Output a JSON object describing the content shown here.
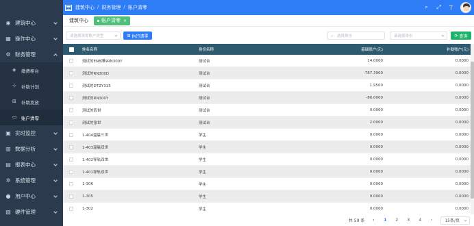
{
  "header": {
    "breadcrumbs": [
      "建筑中心",
      "财务管理",
      "账户清零"
    ]
  },
  "sidebar": {
    "items": [
      {
        "label": "建筑中心",
        "icon": "dashboard-icon"
      },
      {
        "label": "操作中心",
        "icon": "grid-icon"
      },
      {
        "label": "财务管理",
        "icon": "finance-icon",
        "expanded": true
      },
      {
        "label": "实时监控",
        "icon": "monitor-icon"
      },
      {
        "label": "数据分析",
        "icon": "chart-icon"
      },
      {
        "label": "报表中心",
        "icon": "report-icon"
      },
      {
        "label": "系统管理",
        "icon": "gear-icon"
      },
      {
        "label": "用户中心",
        "icon": "user-icon"
      },
      {
        "label": "硬件管理",
        "icon": "hardware-icon"
      }
    ],
    "finance_sub": [
      {
        "label": "缴费柜台",
        "icon": "counter-icon"
      },
      {
        "label": "补助计划",
        "icon": "plan-icon"
      },
      {
        "label": "补助发放",
        "icon": "grant-icon"
      },
      {
        "label": "账户清零",
        "icon": "clear-icon",
        "active": true
      }
    ]
  },
  "tags": {
    "home": "建筑中心",
    "active": "账户清零",
    "close": "×"
  },
  "toolbar": {
    "account_type_placeholder": "请选择清零账户类型",
    "execute_label": "执行清零",
    "role_select_placeholder": "选择身份",
    "role_filter_placeholder": "请选择身份",
    "query_label": "查询"
  },
  "table": {
    "columns": [
      "姓名名称",
      "身份名称",
      "基础账户(元)",
      "补助账户(元)"
    ],
    "rows": [
      {
        "name": "测试的ENB博9RN300Y",
        "role": "测试台",
        "basic": "14.0000",
        "subsidy": "0.0000"
      },
      {
        "name": "测试的RN300D",
        "role": "测试台",
        "basic": "-787.3900",
        "subsidy": "0.0000"
      },
      {
        "name": "测试的DTZY315",
        "role": "测试台",
        "basic": "1.9500",
        "subsidy": "0.0000"
      },
      {
        "name": "测试的RN300Y",
        "role": "测试台",
        "basic": "-86.0000",
        "subsidy": "0.0000"
      },
      {
        "name": "测试的四世",
        "role": "测试台",
        "basic": "0.0000",
        "subsidy": "0.0000"
      },
      {
        "name": "测试的张世",
        "role": "测试台",
        "basic": "2.0000",
        "subsidy": "0.0000"
      },
      {
        "name": "1-404温晨三世",
        "role": "学生",
        "basic": "0.0000",
        "subsidy": "0.0000"
      },
      {
        "name": "1-403温晨双世",
        "role": "学生",
        "basic": "0.0000",
        "subsidy": "0.0000"
      },
      {
        "name": "1-402导轨四世",
        "role": "学生",
        "basic": "0.0000",
        "subsidy": "0.0000"
      },
      {
        "name": "1-401导轨双世",
        "role": "学生",
        "basic": "0.0000",
        "subsidy": "0.0000"
      },
      {
        "name": "1-306",
        "role": "学生",
        "basic": "0.0000",
        "subsidy": "0.0000"
      },
      {
        "name": "1-305",
        "role": "学生",
        "basic": "0.0000",
        "subsidy": "0.0000"
      },
      {
        "name": "1-302",
        "role": "学生",
        "basic": "0.0000",
        "subsidy": "0.0000"
      }
    ]
  },
  "pagination": {
    "total": "共 59 条",
    "prev": "‹",
    "pages": [
      "1",
      "2",
      "3",
      "4"
    ],
    "next": "›",
    "page_size": "15条/页",
    "current": "1"
  }
}
